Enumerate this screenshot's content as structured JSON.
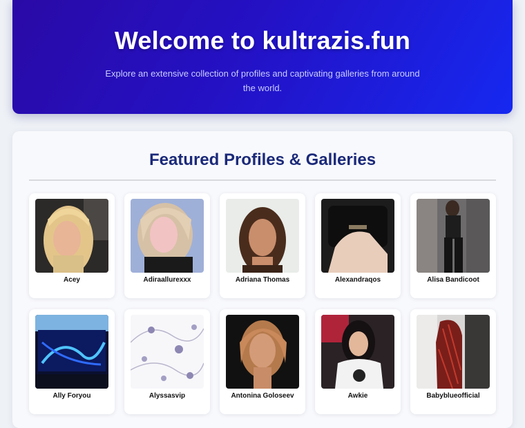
{
  "hero": {
    "title": "Welcome to kultrazis.fun",
    "subtitle": "Explore an extensive collection of profiles and captivating galleries from around the world."
  },
  "featured": {
    "heading": "Featured Profiles & Galleries",
    "profiles": [
      {
        "name": "Acey"
      },
      {
        "name": "Adiraallurexxx"
      },
      {
        "name": "Adriana Thomas"
      },
      {
        "name": "Alexandraqos"
      },
      {
        "name": "Alisa Bandicoot"
      },
      {
        "name": "Ally Foryou"
      },
      {
        "name": "Alyssasvip"
      },
      {
        "name": "Antonina Goloseev"
      },
      {
        "name": "Awkie"
      },
      {
        "name": "Babyblueofficial"
      }
    ]
  },
  "colors": {
    "hero_gradient_start": "#2a0aa6",
    "hero_gradient_end": "#1628f0",
    "heading": "#1b2a7a"
  }
}
